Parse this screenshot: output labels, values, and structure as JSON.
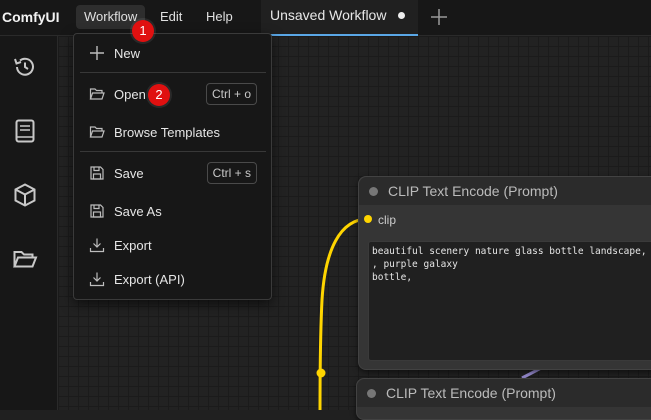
{
  "app": {
    "name": "ComfyUI"
  },
  "menubar": {
    "items": [
      "Workflow",
      "Edit",
      "Help"
    ]
  },
  "tabs": [
    {
      "label": "Unsaved Workflow",
      "unsaved": true
    }
  ],
  "workflow_menu": {
    "items": [
      {
        "label": "New",
        "icon": "plus-icon",
        "shortcut": ""
      },
      {
        "label": "Open",
        "icon": "folder-open-icon",
        "shortcut": "Ctrl + o"
      },
      {
        "label": "Browse Templates",
        "icon": "folder-open-icon",
        "shortcut": ""
      },
      {
        "label": "Save",
        "icon": "save-icon",
        "shortcut": "Ctrl + s"
      },
      {
        "label": "Save As",
        "icon": "save-icon",
        "shortcut": ""
      },
      {
        "label": "Export",
        "icon": "download-icon",
        "shortcut": ""
      },
      {
        "label": "Export (API)",
        "icon": "download-icon",
        "shortcut": ""
      }
    ]
  },
  "sidebar": {
    "icons": [
      "history-icon",
      "book-icon",
      "cube-icon",
      "folder-open-icon"
    ]
  },
  "nodes": [
    {
      "title": "CLIP Text Encode (Prompt)",
      "input_label": "clip",
      "text": "beautiful scenery nature glass bottle landscape, , purple galaxy\nbottle,"
    },
    {
      "title": "CLIP Text Encode (Prompt)"
    }
  ],
  "annotations": {
    "step1": "1",
    "step2": "2"
  },
  "colors": {
    "accent_tab": "#5aa7e6",
    "clip_link": "#ffd500",
    "badge": "#e01010"
  }
}
